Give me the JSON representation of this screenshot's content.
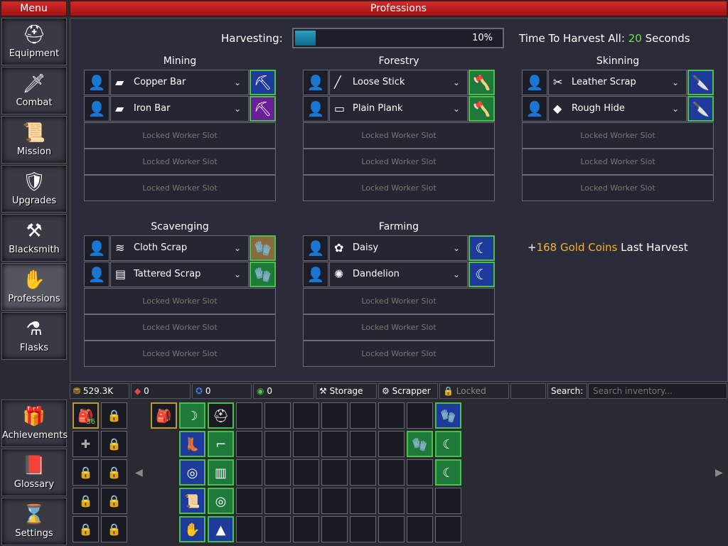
{
  "header": {
    "menu": "Menu",
    "title": "Professions"
  },
  "nav": [
    {
      "label": "Equipment",
      "icon": "helmet-icon",
      "glyph": "⛑"
    },
    {
      "label": "Combat",
      "icon": "sword-icon",
      "glyph": "🗡"
    },
    {
      "label": "Mission",
      "icon": "scroll-icon",
      "glyph": "📜"
    },
    {
      "label": "Upgrades",
      "icon": "shield-icon",
      "glyph": "🛡"
    },
    {
      "label": "Blacksmith",
      "icon": "anvil-icon",
      "glyph": "⚒"
    },
    {
      "label": "Professions",
      "icon": "hand-icon",
      "glyph": "✋"
    },
    {
      "label": "Flasks",
      "icon": "flask-icon",
      "glyph": "⚗"
    }
  ],
  "nav2": [
    {
      "label": "Achievements",
      "icon": "chest-icon",
      "glyph": "🎁"
    },
    {
      "label": "Glossary",
      "icon": "book-icon",
      "glyph": "📕"
    },
    {
      "label": "Settings",
      "icon": "hourglass-icon",
      "glyph": "⌛"
    }
  ],
  "harvest": {
    "label": "Harvesting:",
    "percent": "10%",
    "progress": 0.1,
    "time_label": "Time To Harvest All:",
    "time_value": "20",
    "time_unit": "Seconds"
  },
  "locked_label": "Locked Worker Slot",
  "sections": [
    {
      "name": "Mining",
      "rows": [
        {
          "resource": "Copper Bar",
          "icon": "copper-bar-icon",
          "glyph": "▰",
          "tool": "pickaxe-icon",
          "toolglyph": "⛏"
        },
        {
          "resource": "Iron Bar",
          "icon": "iron-bar-icon",
          "glyph": "▰",
          "tool": "pickaxe-icon",
          "toolglyph": "⛏"
        }
      ]
    },
    {
      "name": "Forestry",
      "rows": [
        {
          "resource": "Loose Stick",
          "icon": "stick-icon",
          "glyph": "╱",
          "tool": "axe-icon",
          "toolglyph": "🪓"
        },
        {
          "resource": "Plain Plank",
          "icon": "plank-icon",
          "glyph": "▭",
          "tool": "axe-icon",
          "toolglyph": "🪓"
        }
      ]
    },
    {
      "name": "Skinning",
      "rows": [
        {
          "resource": "Leather Scrap",
          "icon": "leather-icon",
          "glyph": "✂",
          "tool": "knife-icon",
          "toolglyph": "🔪"
        },
        {
          "resource": "Rough Hide",
          "icon": "hide-icon",
          "glyph": "◆",
          "tool": "knife-icon",
          "toolglyph": "🔪"
        }
      ]
    },
    {
      "name": "Scavenging",
      "rows": [
        {
          "resource": "Cloth Scrap",
          "icon": "cloth-icon",
          "glyph": "≋",
          "tool": "glove-icon",
          "toolglyph": "🧤"
        },
        {
          "resource": "Tattered Scrap",
          "icon": "tattered-icon",
          "glyph": "▤",
          "tool": "glove-icon",
          "toolglyph": "🧤"
        }
      ]
    },
    {
      "name": "Farming",
      "rows": [
        {
          "resource": "Daisy",
          "icon": "daisy-icon",
          "glyph": "✿",
          "tool": "sickle-icon",
          "toolglyph": "☾"
        },
        {
          "resource": "Dandelion",
          "icon": "dandelion-icon",
          "glyph": "✺",
          "tool": "sickle-icon",
          "toolglyph": "☾"
        }
      ]
    }
  ],
  "last_harvest": {
    "prefix": "+",
    "amount": "168 Gold Coins",
    "suffix": " Last Harvest"
  },
  "stats": {
    "gold": "529.3K",
    "red": "0",
    "blue": "0",
    "green": "0",
    "storage": "Storage",
    "scrapper": "Scrapper",
    "locked": "Locked",
    "search_label": "Search:",
    "search_placeholder": "Search inventory..."
  },
  "bag_count": "36",
  "colors": {
    "accent_red": "#c41e1e",
    "gold": "#f0b42a",
    "green": "#6ee04a"
  }
}
